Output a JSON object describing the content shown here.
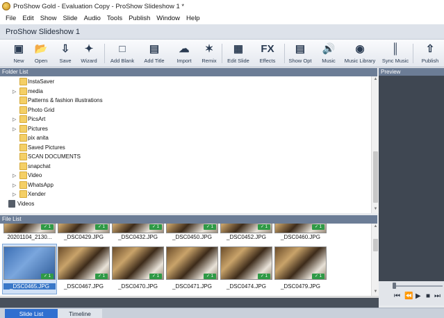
{
  "window": {
    "title": "ProShow Gold - Evaluation Copy - ProShow Slideshow 1 *"
  },
  "menu": [
    "File",
    "Edit",
    "Show",
    "Slide",
    "Audio",
    "Tools",
    "Publish",
    "Window",
    "Help"
  ],
  "show": {
    "title": "ProShow Slideshow 1"
  },
  "toolbar": {
    "new": "New",
    "open": "Open",
    "save": "Save",
    "wizard": "Wizard",
    "add_blank": "Add Blank",
    "add_title": "Add Title",
    "import": "Import",
    "remix": "Remix",
    "edit_slide": "Edit Slide",
    "effects": "Effects",
    "show_opt": "Show Opt",
    "music": "Music",
    "music_library": "Music Library",
    "sync_music": "Sync Music",
    "publish": "Publish",
    "effects_glyph": "FX"
  },
  "folder_list": {
    "header": "Folder List",
    "items": [
      {
        "name": "InstaSaver",
        "expandable": false
      },
      {
        "name": "media",
        "expandable": true
      },
      {
        "name": "Patterns & fashion illustrations",
        "expandable": false
      },
      {
        "name": "Photo Grid",
        "expandable": false
      },
      {
        "name": "PicsArt",
        "expandable": true
      },
      {
        "name": "Pictures",
        "expandable": true
      },
      {
        "name": "pix anita",
        "expandable": false
      },
      {
        "name": "Saved Pictures",
        "expandable": false
      },
      {
        "name": "SCAN DOCUMENTS",
        "expandable": false
      },
      {
        "name": "snapchat",
        "expandable": false
      },
      {
        "name": "Video",
        "expandable": true
      },
      {
        "name": "WhatsApp",
        "expandable": true
      },
      {
        "name": "Xender",
        "expandable": true
      }
    ],
    "drive": "Videos"
  },
  "file_list": {
    "header": "File List",
    "row1": [
      "20201104_2130...",
      "_DSC0429.JPG",
      "_DSC0432.JPG",
      "_DSC0450.JPG",
      "_DSC0452.JPG",
      "_DSC0460.JPG"
    ],
    "row2": [
      "_DSC0465.JPG",
      "_DSC0467.JPG",
      "_DSC0470.JPG",
      "_DSC0471.JPG",
      "_DSC0474.JPG",
      "_DSC0479.JPG"
    ],
    "badge": "✓ 1",
    "selected": "_DSC0465.JPG"
  },
  "preview": {
    "header": "Preview"
  },
  "tabs": {
    "slide_list": "Slide List",
    "timeline": "Timeline"
  },
  "colors": {
    "panel_header": "#6c7d96",
    "selection": "#3a78c8",
    "tab_active": "#2f6fd0"
  }
}
